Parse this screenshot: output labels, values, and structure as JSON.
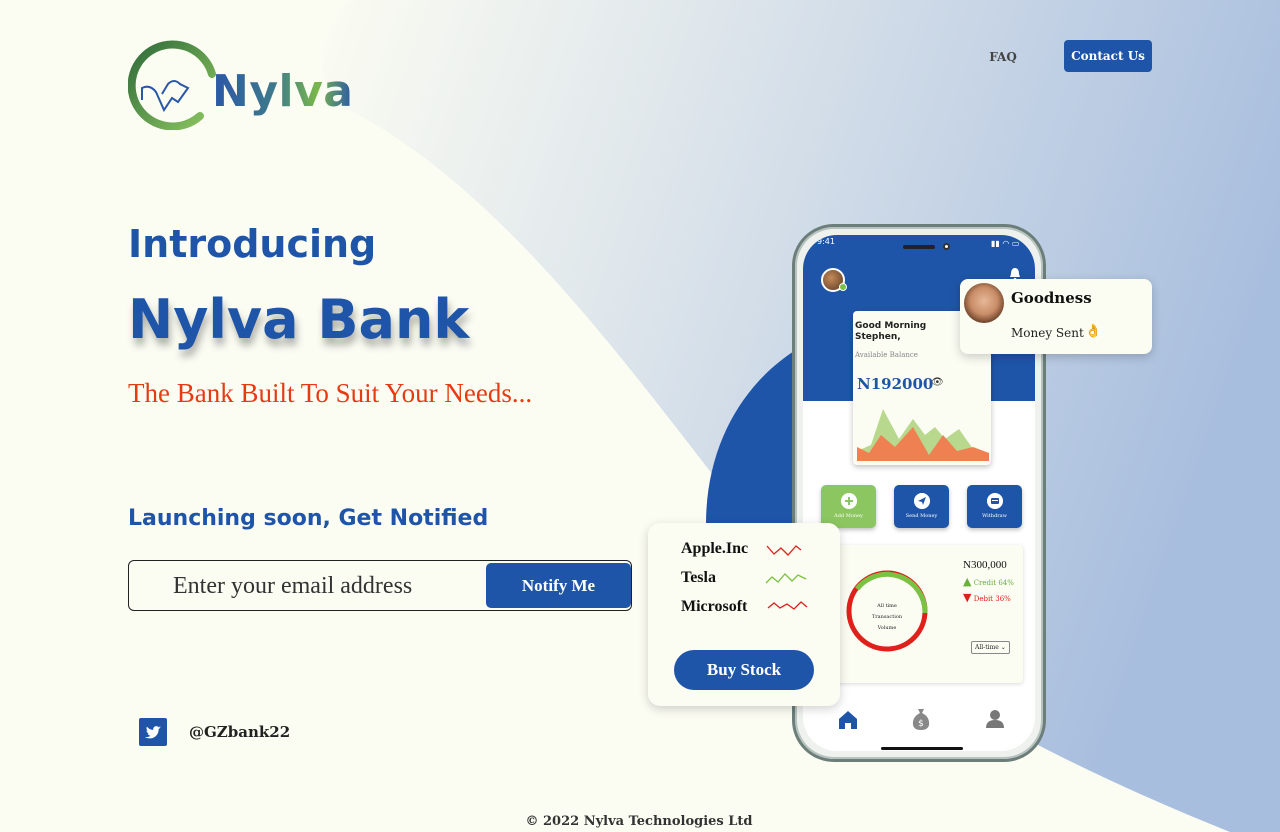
{
  "brand": {
    "name": "Nylva"
  },
  "nav": {
    "faq": "FAQ",
    "contact": "Contact Us"
  },
  "hero": {
    "intro": "Introducing",
    "title": "Nylva Bank",
    "tagline": "The Bank Built To Suit Your Needs...",
    "launch": "Launching soon, Get Notified",
    "email_placeholder": "Enter your email address",
    "notify_button": "Notify Me"
  },
  "social": {
    "handle": "@GZbank22",
    "icon": "twitter-icon"
  },
  "footer": {
    "copyright": "© 2022 Nylva Technologies Ltd"
  },
  "phone": {
    "status_time": "9:41",
    "greeting_line1": "Good Morning",
    "greeting_line2": "Stephen,",
    "available_label": "Available Balance",
    "balance": "N192000",
    "actions": [
      {
        "label": "Add Money",
        "icon": "add-icon",
        "color": "#8cc660"
      },
      {
        "label": "Send Money",
        "icon": "send-icon",
        "color": "#1f55a8"
      },
      {
        "label": "Withdraw",
        "icon": "wallet-icon",
        "color": "#1f55a8"
      }
    ],
    "volume": {
      "amount": "N300,000",
      "credit_label": "Credit",
      "credit_pct": "64%",
      "debit_label": "Debit",
      "debit_pct": "36%",
      "center_line1": "All time",
      "center_line2": "Transaction",
      "center_line3": "Volume",
      "filter": "All-time"
    }
  },
  "notification": {
    "name": "Goodness",
    "message": "Money Sent"
  },
  "stocks": {
    "items": [
      {
        "name": "Apple.Inc",
        "trend": "down",
        "color": "#e0201a"
      },
      {
        "name": "Tesla",
        "trend": "up",
        "color": "#7bc142"
      },
      {
        "name": "Microsoft",
        "trend": "down",
        "color": "#e0201a"
      }
    ],
    "button": "Buy Stock"
  },
  "colors": {
    "primary": "#1f55a8",
    "accent": "#e63b12",
    "green": "#7bc142",
    "background": "#fbfcf2"
  }
}
